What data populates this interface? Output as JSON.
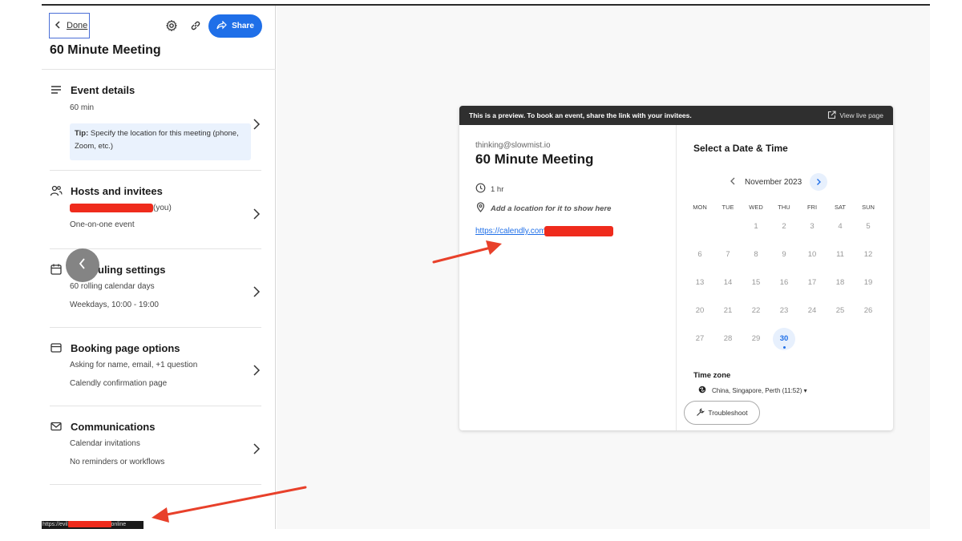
{
  "header": {
    "done_label": "Done",
    "share_label": "Share",
    "title": "60 Minute Meeting"
  },
  "sections": [
    {
      "title": "Event details",
      "lines": [
        "60 min"
      ],
      "icon": "lines-icon"
    },
    {
      "title": "Hosts and invitees",
      "lines": [
        "(you)",
        "One-on-one event"
      ],
      "icon": "people-icon"
    },
    {
      "title": "uling settings",
      "lines": [
        "60 rolling calendar days",
        "Weekdays, 10:00 - 19:00"
      ],
      "icon": "calendar-icon"
    },
    {
      "title": "Booking page options",
      "lines": [
        "Asking for name, email, +1 question",
        "Calendly confirmation page"
      ],
      "icon": "window-icon"
    },
    {
      "title": "Communications",
      "lines": [
        "Calendar invitations",
        "No reminders or workflows"
      ],
      "icon": "mail-icon"
    }
  ],
  "tip": {
    "bold": "Tip:",
    "text": " Specify the location for this meeting (phone, Zoom, etc.)"
  },
  "status_bar": {
    "prefix": "https://evil",
    "suffix": "online"
  },
  "preview": {
    "banner": "This is a preview. To book an event, share the link with your invitees.",
    "view_live": "View live page",
    "email": "thinking@slowmist.io",
    "title": "60 Minute Meeting",
    "duration": "1 hr",
    "location_hint": "Add a location for it to show here",
    "link_text": "https://calendly.com"
  },
  "calendar": {
    "title": "Select a Date & Time",
    "month": "November 2023",
    "weekdays": [
      "MON",
      "TUE",
      "WED",
      "THU",
      "FRI",
      "SAT",
      "SUN"
    ],
    "weeks": [
      [
        "",
        "",
        "1",
        "2",
        "3",
        "4",
        "5"
      ],
      [
        "6",
        "7",
        "8",
        "9",
        "10",
        "11",
        "12"
      ],
      [
        "13",
        "14",
        "15",
        "16",
        "17",
        "18",
        "19"
      ],
      [
        "20",
        "21",
        "22",
        "23",
        "24",
        "25",
        "26"
      ],
      [
        "27",
        "28",
        "29",
        "30",
        "",
        "",
        ""
      ]
    ],
    "selected_day": "30",
    "timezone_label": "Time zone",
    "timezone_value": "China, Singapore, Perth (11:52) ▾",
    "troubleshoot_label": "Troubleshoot"
  },
  "colors": {
    "accent": "#1f6fe8",
    "redaction": "#ef2b1c",
    "annotation_arrow": "#e8402a"
  }
}
